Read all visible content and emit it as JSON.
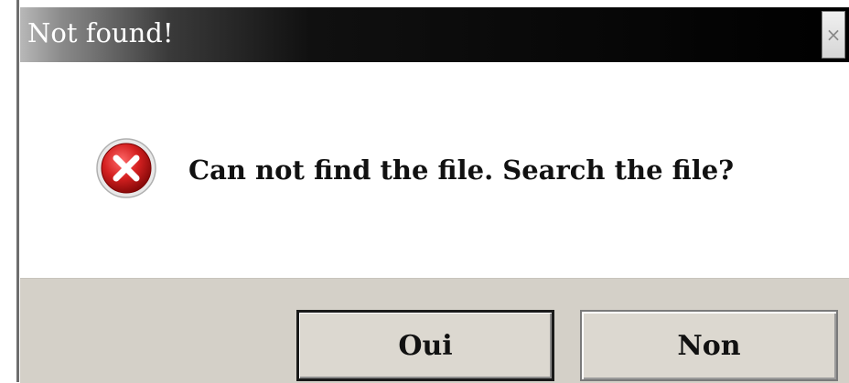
{
  "dialog": {
    "title": "Not found!",
    "close_symbol": "×",
    "icon": "error-icon",
    "message": "Can not find the file. Search the file?",
    "buttons": {
      "yes_label": "Oui",
      "no_label": "Non"
    }
  },
  "colors": {
    "titlebar": "#000000",
    "button_face": "#d4d0c8",
    "error_red": "#d42020"
  }
}
